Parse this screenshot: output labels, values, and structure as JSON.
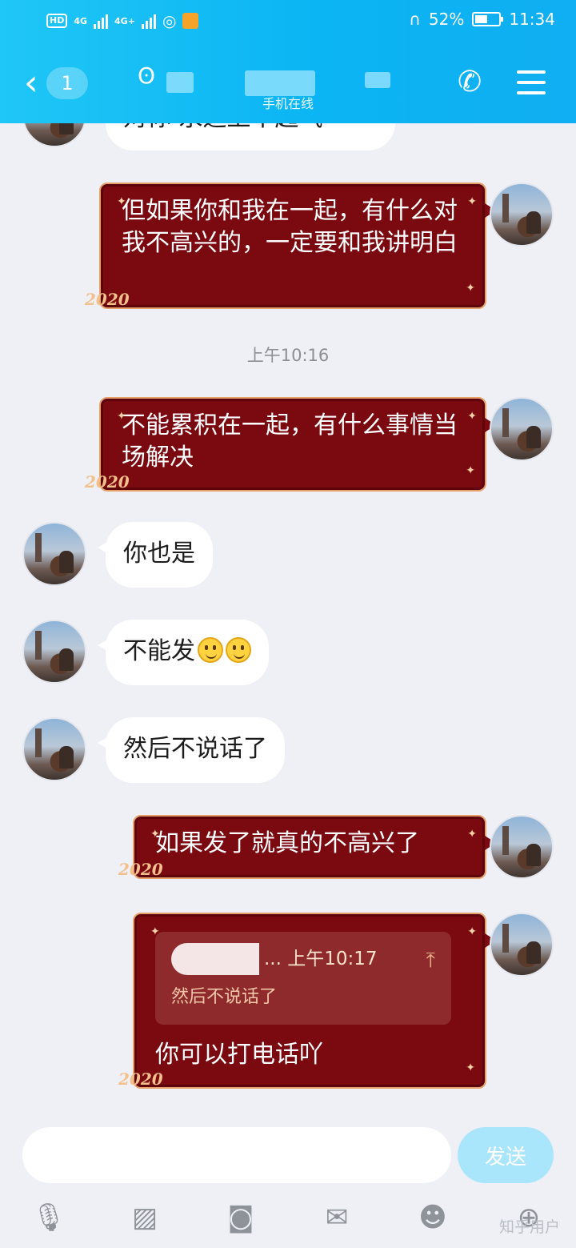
{
  "status_bar": {
    "network_hd": "HD",
    "signal1": "4G",
    "signal2": "4G+",
    "battery": "52%",
    "battery_level": 0.52,
    "time": "11:34"
  },
  "header": {
    "back_count": "1",
    "contact_status": "手机在线"
  },
  "messages": [
    {
      "side": "in",
      "text": "对你 永远上不起气"
    },
    {
      "side": "out",
      "text": "但如果你和我在一起，有什么对我不高兴的，一定要和我讲明白"
    },
    {
      "side": "time",
      "text": "上午10:16"
    },
    {
      "side": "out",
      "text": "不能累积在一起，有什么事情当场解决"
    },
    {
      "side": "in",
      "text": "你也是"
    },
    {
      "side": "in",
      "text": "不能发"
    },
    {
      "side": "in",
      "text": "然后不说话了"
    },
    {
      "side": "out",
      "text": "如果发了就真的不高兴了"
    },
    {
      "side": "out",
      "quote": {
        "head": "... 上午10:17",
        "body": "然后不说话了"
      },
      "text": "你可以打电话吖"
    }
  ],
  "bubble_deco": "2020",
  "input": {
    "placeholder": "",
    "send_label": "发送"
  },
  "toolbar": [
    "mic-icon",
    "image-icon",
    "camera-icon",
    "red-packet-icon",
    "emoji-icon",
    "plus-icon"
  ],
  "watermark": "知乎用户"
}
